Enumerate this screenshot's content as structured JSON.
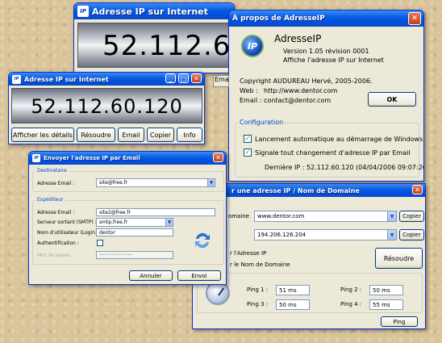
{
  "app_title": "Adresse IP sur Internet",
  "app_icon": "IP",
  "ip_address": "52.112.60.120",
  "ip_partial_back": "52.112.60",
  "main_buttons": [
    "Afficher les détails",
    "Résoudre",
    "Email",
    "Copier",
    "Info"
  ],
  "about": {
    "title": "À propos de AdresseIP",
    "app_name": "AdresseIP",
    "version": "Version 1.05 révision 0001",
    "description": "Affiche l'adresse IP sur Internet",
    "copyright": "Copyright AUDUREAU Hervé, 2005-2006.",
    "web_label": "Web :",
    "web_value": "http://www.dentor.com",
    "email_label": "Email :",
    "email_value": "contact@dentor.com",
    "ok_label": "OK",
    "config_label": "Configuration",
    "option1": "Lancement automatique au démarrage de Windows",
    "option2": "Signale tout changement d'adresse IP par Email",
    "last_ip": "Dernière IP : 52.112.60.120 (04/04/2006 09:07:26)",
    "behind_tab": "Ema"
  },
  "email_dialog": {
    "title": "Envoyer l'adresse IP par Email",
    "recipient_group": "Destinataire",
    "recipient_label": "Adresse Email :",
    "recipient_value": "site@free.fr",
    "sender_group": "Expéditeur",
    "sender_email_label": "Adresse Email :",
    "sender_email_value": "site2@free.fr",
    "smtp_label": "Serveur sortant (SMTP) :",
    "smtp_value": "smtp.free.fr",
    "login_label": "Nom d'utilisateur (Login) :",
    "login_value": "dentor",
    "auth_label": "Authentification :",
    "password_label": "Mot de passe :",
    "password_value": "••••••••••••••",
    "cancel_label": "Annuler",
    "send_label": "Envoi"
  },
  "resolve_dialog": {
    "title_fragment": "r une adresse IP / Nom de Domaine",
    "domain_label": "omaine",
    "domain_value": "www.dentor.com",
    "ip_value": "194.206.126.204",
    "copy_label": "Copier",
    "radio_ip_label": "r l'Adresse IP",
    "radio_domain_label": "r le Nom de Domaine",
    "resolve_label": "Résoudre",
    "pings": [
      {
        "label": "Ping 1 :",
        "value": "51 ms"
      },
      {
        "label": "Ping 2 :",
        "value": "50 ms"
      },
      {
        "label": "Ping 3 :",
        "value": "50 ms"
      },
      {
        "label": "Ping 4 :",
        "value": "55 ms"
      }
    ],
    "ping_label": "Ping"
  }
}
